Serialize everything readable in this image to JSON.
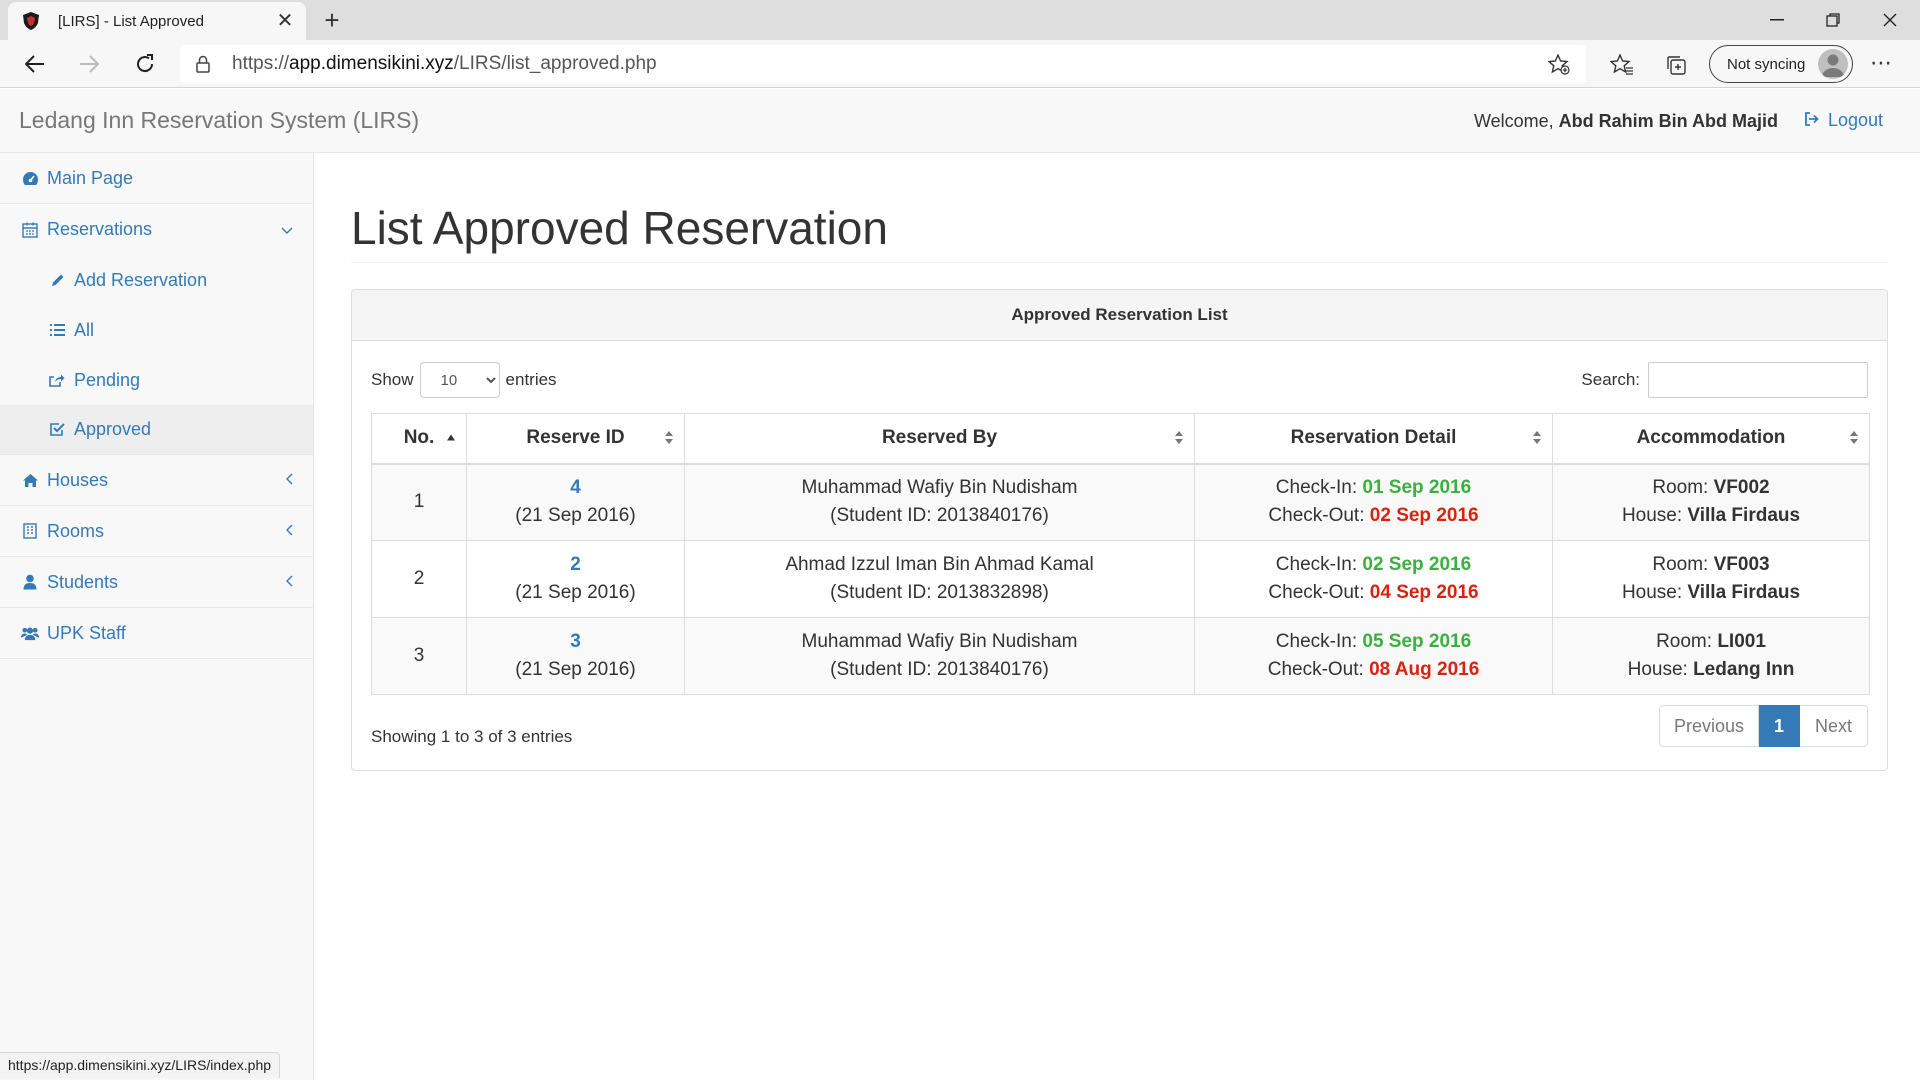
{
  "browser": {
    "tab_title": "[LIRS] - List Approved",
    "url_prefix": "https://",
    "url_host": "app.dimensikini.xyz",
    "url_path": "/LIRS/list_approved.php",
    "sync_label": "Not syncing",
    "status_url": "https://app.dimensikini.xyz/LIRS/index.php"
  },
  "header": {
    "brand": "Ledang Inn Reservation System (LIRS)",
    "welcome_prefix": "Welcome,",
    "user_name": "Abd Rahim Bin Abd Majid",
    "logout_label": "Logout"
  },
  "sidebar": {
    "main_page": "Main Page",
    "reservations": "Reservations",
    "add_reservation": "Add Reservation",
    "all": "All",
    "pending": "Pending",
    "approved": "Approved",
    "houses": "Houses",
    "rooms": "Rooms",
    "students": "Students",
    "upk_staff": "UPK Staff"
  },
  "main": {
    "page_title": "List Approved Reservation",
    "panel_title": "Approved Reservation List",
    "show_label": "Show",
    "entries_value": "10",
    "entries_label": "entries",
    "search_label": "Search:",
    "columns": [
      "No.",
      "Reserve ID",
      "Reserved By",
      "Reservation Detail",
      "Accommodation"
    ],
    "rows": [
      {
        "no": "1",
        "reserve_id": "4",
        "reserve_date": "(21 Sep 2016)",
        "name": "Muhammad Wafiy Bin Nudisham",
        "student_id": "(Student ID: 2013840176)",
        "checkin_label": "Check-In:",
        "checkin": "01 Sep 2016",
        "checkout_label": "Check-Out:",
        "checkout": "02 Sep 2016",
        "room_label": "Room:",
        "room": "VF002",
        "house_label": "House:",
        "house": "Villa Firdaus"
      },
      {
        "no": "2",
        "reserve_id": "2",
        "reserve_date": "(21 Sep 2016)",
        "name": "Ahmad Izzul Iman Bin Ahmad Kamal",
        "student_id": "(Student ID: 2013832898)",
        "checkin_label": "Check-In:",
        "checkin": "02 Sep 2016",
        "checkout_label": "Check-Out:",
        "checkout": "04 Sep 2016",
        "room_label": "Room:",
        "room": "VF003",
        "house_label": "House:",
        "house": "Villa Firdaus"
      },
      {
        "no": "3",
        "reserve_id": "3",
        "reserve_date": "(21 Sep 2016)",
        "name": "Muhammad Wafiy Bin Nudisham",
        "student_id": "(Student ID: 2013840176)",
        "checkin_label": "Check-In:",
        "checkin": "05 Sep 2016",
        "checkout_label": "Check-Out:",
        "checkout": "08 Aug 2016",
        "room_label": "Room:",
        "room": "LI001",
        "house_label": "House:",
        "house": "Ledang Inn"
      }
    ],
    "info": "Showing 1 to 3 of 3 entries",
    "pager": {
      "previous": "Previous",
      "current": "1",
      "next": "Next"
    }
  },
  "colors": {
    "link": "#337ab7",
    "checkin": "#3ab03e",
    "checkout": "#d9230f"
  }
}
